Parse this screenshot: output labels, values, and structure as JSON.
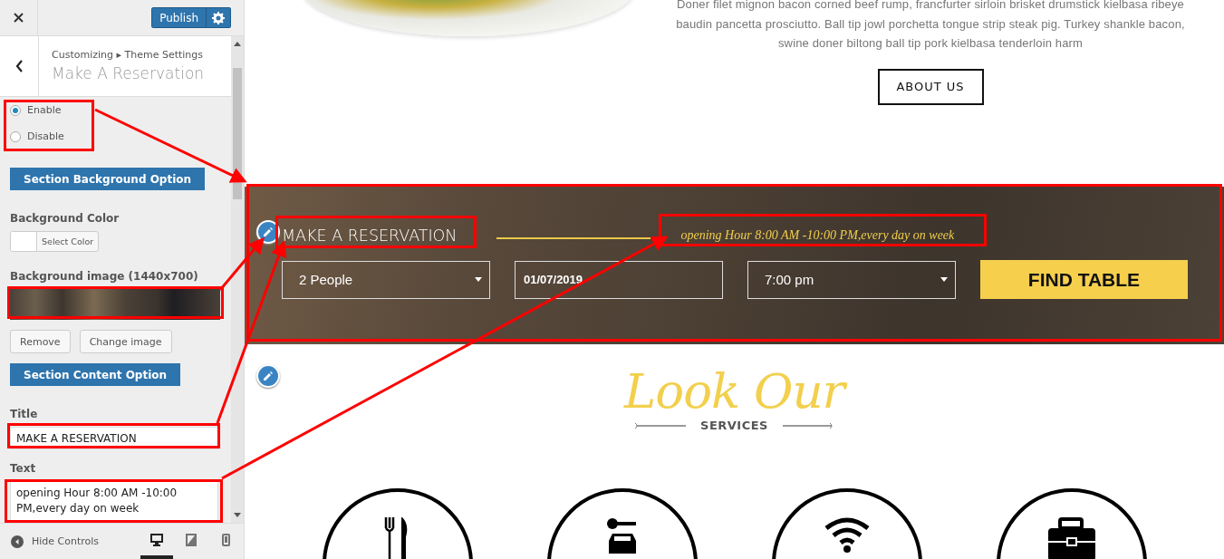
{
  "customizer": {
    "publish_button": "Publish",
    "breadcrumb": "Customizing ▸ Theme Settings",
    "section_title": "Make A Reservation",
    "visibility_options": [
      {
        "label": "Enable",
        "selected": true
      },
      {
        "label": "Disable",
        "selected": false
      }
    ],
    "controls": [
      {
        "kind": "section_button",
        "label": "Section Background Option"
      },
      {
        "kind": "color",
        "label": "Background Color",
        "button": "Select Color"
      },
      {
        "kind": "image",
        "label": "Background image (1440x700)",
        "buttons": [
          "Remove",
          "Change image"
        ]
      },
      {
        "kind": "section_button",
        "label": "Section Content Option"
      },
      {
        "kind": "text",
        "label": "Title",
        "value": "MAKE A RESERVATION"
      },
      {
        "kind": "textarea",
        "label": "Text",
        "value": "opening Hour 8:00 AM -10:00 PM,every day on week"
      }
    ],
    "footer": {
      "hide_controls": "Hide Controls",
      "devices": [
        {
          "kind": "desktop",
          "selected": true
        },
        {
          "kind": "tablet",
          "selected": false
        },
        {
          "kind": "mobile",
          "selected": false
        }
      ]
    }
  },
  "preview": {
    "about_text": "Doner filet mignon bacon corned beef rump, francfurter sirloin brisket drumstick kielbasa ribeye baudin pancetta prosciutto. Ball tip jowl porchetta tongue strip steak pig. Turkey shankle bacon, swine doner biltong ball tip pork kielbasa tenderloin harm",
    "about_button": "ABOUT US",
    "reservation": {
      "title": "MAKE A RESERVATION",
      "hours": "opening Hour 8:00 AM -10:00 PM,every day on week",
      "party_size": "2 People",
      "date": "01/07/2019",
      "time": "7:00 pm",
      "button": "FIND TABLE"
    },
    "services": {
      "heading": "Look Our",
      "subheading": "SERVICES"
    }
  }
}
